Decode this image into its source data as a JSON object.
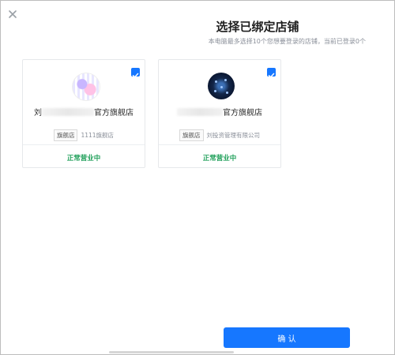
{
  "dialog": {
    "title": "选择已绑定店铺",
    "subtitle": "本电脑最多选择10个您想要登录的店铺，当前已登录0个"
  },
  "shops": [
    {
      "name_prefix": "刘",
      "name_suffix": "官方旗舰店",
      "tag": "旗舰店",
      "detail": "1111旗舰店",
      "status": "正常营业中",
      "checked": true
    },
    {
      "name_prefix": "",
      "name_suffix": "官方旗舰店",
      "tag": "旗舰店",
      "detail": "刘投资管理有限公司",
      "status": "正常营业中",
      "checked": true
    }
  ],
  "footer": {
    "confirm_label": "确 认"
  },
  "colors": {
    "accent": "#1677ff",
    "status_ok": "#20a05a"
  }
}
